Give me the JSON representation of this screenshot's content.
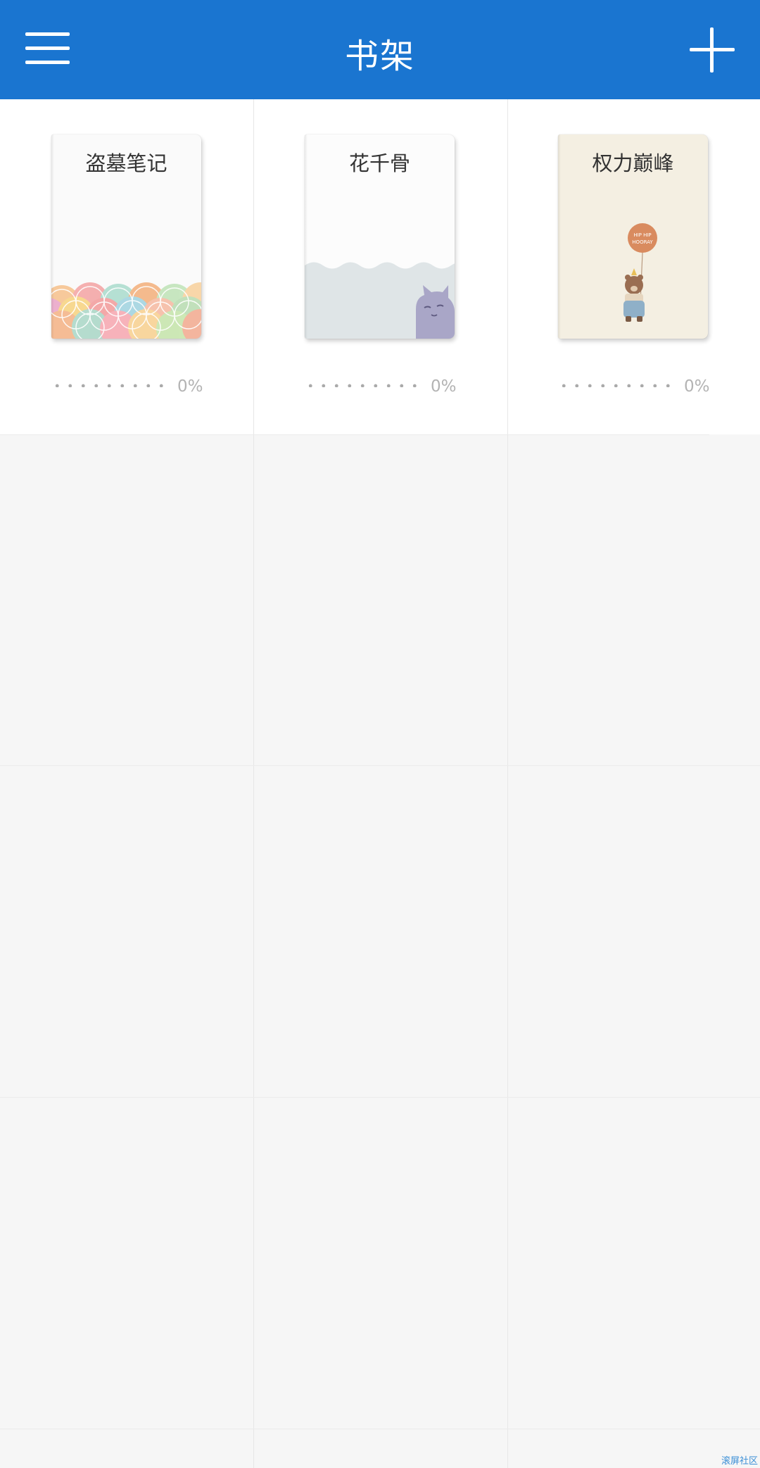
{
  "header": {
    "title": "书架",
    "menu_icon": "hamburger-menu-icon",
    "add_icon": "plus-icon",
    "background": "#1a75d0"
  },
  "books": [
    {
      "title": "盗墓笔记",
      "progress": "0%",
      "cover": "watercolor-scales"
    },
    {
      "title": "花千骨",
      "progress": "0%",
      "cover": "gray-cat-wave"
    },
    {
      "title": "权力巅峰",
      "progress": "0%",
      "cover": "bear-balloon",
      "balloon_text": "HIP HIP HOORAY"
    }
  ],
  "watermark": "滚屏社区"
}
